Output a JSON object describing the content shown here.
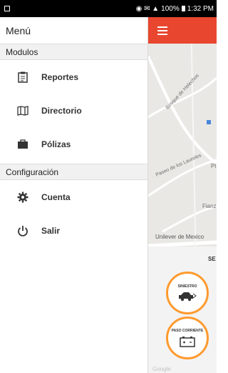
{
  "status": {
    "right_text": "100%",
    "time": "1:32 PM"
  },
  "drawer": {
    "title": "Menú",
    "sections": [
      {
        "title": "Modulos",
        "items": [
          {
            "label": "Reportes",
            "icon": "clipboard-icon"
          },
          {
            "label": "Directorio",
            "icon": "map-icon"
          },
          {
            "label": "Pólizas",
            "icon": "briefcase-icon"
          }
        ]
      },
      {
        "title": "Configuración",
        "items": [
          {
            "label": "Cuenta",
            "icon": "gear-icon"
          },
          {
            "label": "Salir",
            "icon": "power-icon"
          }
        ]
      }
    ]
  },
  "map": {
    "labels": [
      "Bosque de Helechos",
      "Paseo de los Laureles",
      "Pl",
      "Fianz",
      "Unilever de Mexico"
    ],
    "panel_title": "SE",
    "buttons": [
      "SINIESTRO",
      "PASO CORRIENTE"
    ],
    "attribution": "Google"
  },
  "colors": {
    "toolbar": "#e8462f",
    "accent_ring": "#ff9a2e"
  }
}
